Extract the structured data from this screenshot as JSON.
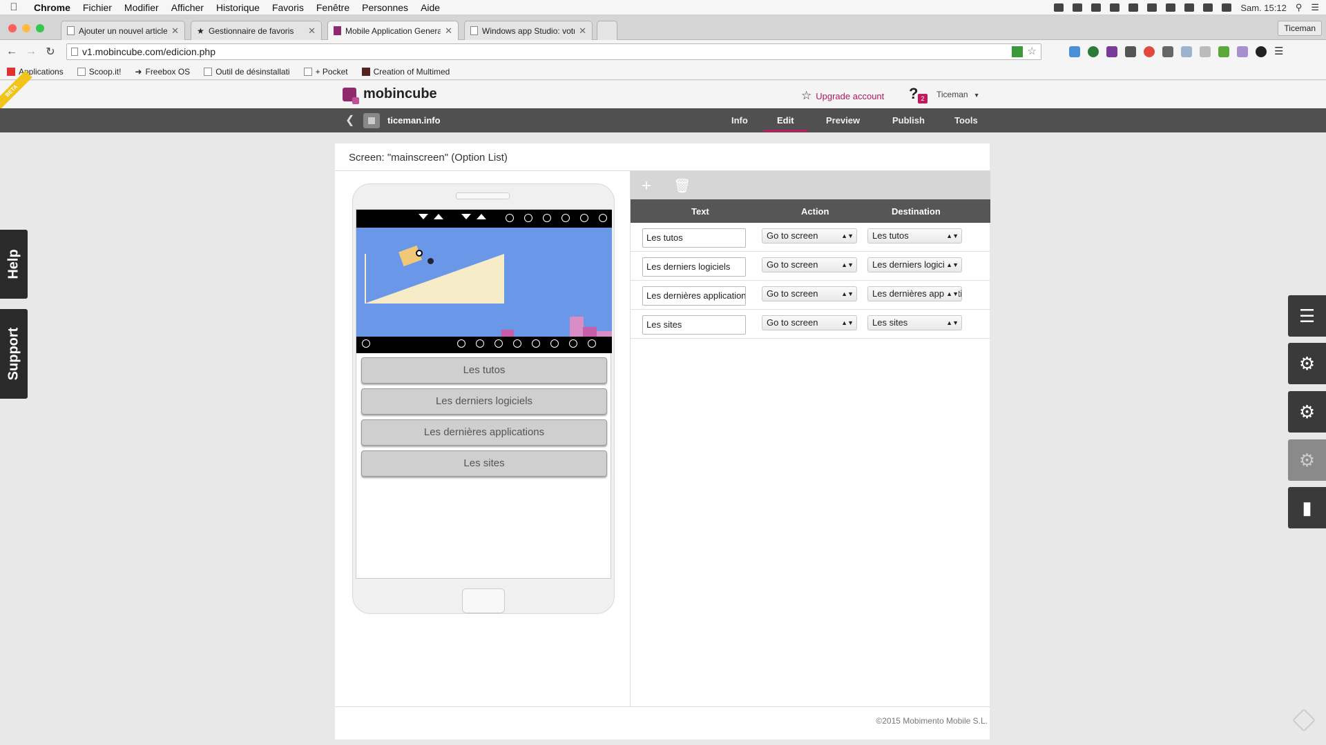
{
  "menubar": {
    "app": "Chrome",
    "items": [
      "Fichier",
      "Modifier",
      "Afficher",
      "Historique",
      "Favoris",
      "Fenêtre",
      "Personnes",
      "Aide"
    ],
    "clock": "Sam. 15:12"
  },
  "tabs": [
    {
      "label": "Ajouter un nouvel article ‹ I"
    },
    {
      "label": "Gestionnaire de favoris"
    },
    {
      "label": "Mobile Application Genera"
    },
    {
      "label": "Windows app Studio: votre"
    }
  ],
  "profile_button": "Ticeman",
  "address": {
    "url": "v1.mobincube.com/edicion.php"
  },
  "bookmarks": [
    "Applications",
    "Scoop.it!",
    "Freebox OS",
    "Outil de désinstallati",
    "+ Pocket",
    "Creation of Multimed"
  ],
  "header": {
    "brand": "mobincube",
    "beta": "BETA",
    "upgrade_label": "Upgrade account",
    "help_badge": "2",
    "user_name": "Ticeman"
  },
  "nav": {
    "app_name": "ticeman.info",
    "tabs": [
      "Info",
      "Edit",
      "Preview",
      "Publish",
      "Tools"
    ],
    "active_tab": "Edit",
    "accent_color": "#c0195f"
  },
  "side_tabs": {
    "help": "Help",
    "support": "Support"
  },
  "panel": {
    "title": "Screen: \"mainscreen\" (Option List)",
    "copyright": "©2015 Mobimento Mobile S.L."
  },
  "phone_options": [
    "Les tutos",
    "Les derniers logiciels",
    "Les dernières applications",
    "Les sites"
  ],
  "table": {
    "headers": [
      "Text",
      "Action",
      "Destination"
    ],
    "rows": [
      {
        "text": "Les tutos",
        "action": "Go to screen",
        "destination": "Les tutos"
      },
      {
        "text": "Les derniers logiciels",
        "action": "Go to screen",
        "destination": "Les derniers logiciels"
      },
      {
        "text": "Les dernières applications",
        "action": "Go to screen",
        "destination": "Les dernières applications"
      },
      {
        "text": "Les sites",
        "action": "Go to screen",
        "destination": "Les sites"
      }
    ]
  }
}
